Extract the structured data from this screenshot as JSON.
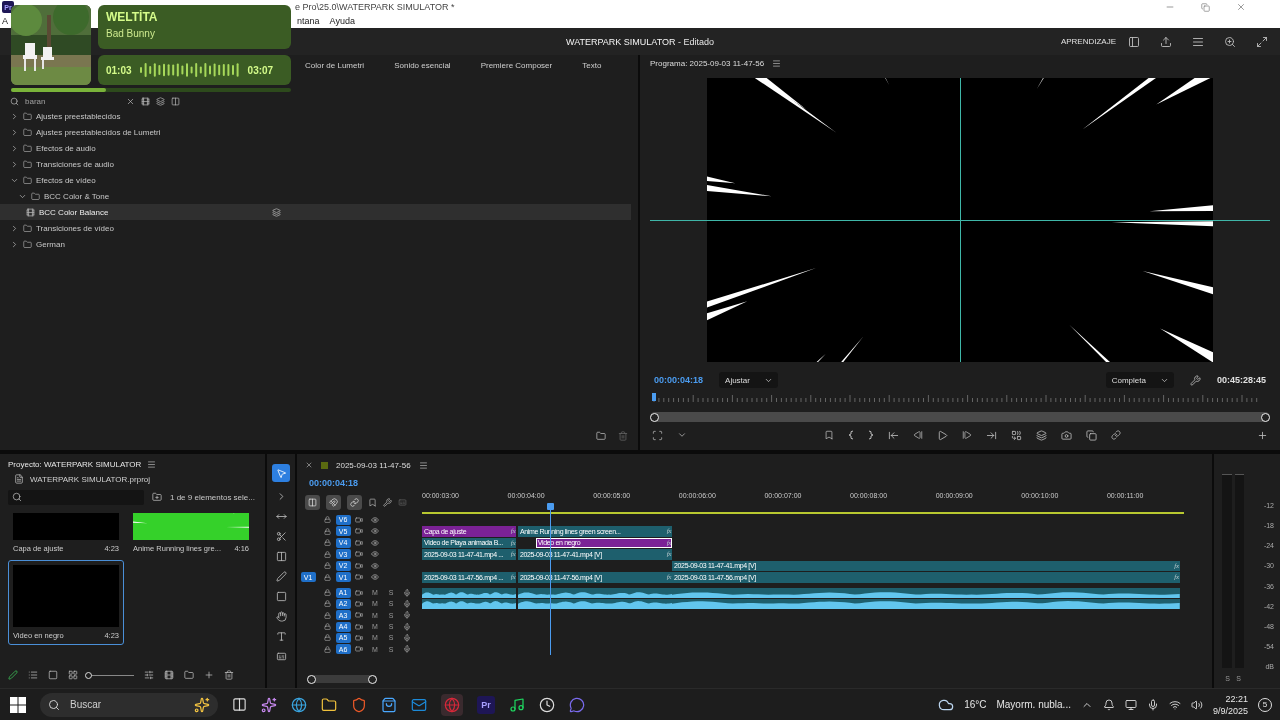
{
  "title_bar": {
    "app_badge": "Pr",
    "title": "e Pro\\25.0\\WATERPARK SIMULATOR *"
  },
  "menu": [
    "A",
    "ntana",
    "Ayuda"
  ],
  "header": {
    "title": "WATERPARK SIMULATOR",
    "status": "- Editado",
    "learn": "APRENDIZAJE"
  },
  "now_playing": {
    "title": "WELTİTA",
    "artist": "Bad Bunny",
    "elapsed": "01:03",
    "total": "03:07",
    "level": 0.34
  },
  "effects": {
    "tabs": [
      {
        "label": "Color de Lumetri",
        "selected": false
      },
      {
        "label": "Sonido esencial",
        "selected": false
      },
      {
        "label": "Premiere Composer",
        "selected": false
      },
      {
        "label": "Texto",
        "selected": false
      }
    ],
    "search": {
      "value": "baran"
    },
    "tree": [
      {
        "label": "Ajustes preestablecidos",
        "expanded": false,
        "selected": false
      },
      {
        "label": "Ajustes preestablecidos de Lumetri",
        "expanded": false,
        "selected": false
      },
      {
        "label": "Efectos de audio",
        "expanded": false,
        "selected": false
      },
      {
        "label": "Transiciones de audio",
        "expanded": false,
        "selected": false
      },
      {
        "label": "Efectos de vídeo",
        "expanded": true,
        "selected": false,
        "children": [
          {
            "label": "BCC Color & Tone",
            "expanded": true,
            "selected": false,
            "children": [
              {
                "label": "BCC Color Balance",
                "kind": "effect",
                "selected": true
              }
            ]
          }
        ]
      },
      {
        "label": "Transiciones de vídeo",
        "expanded": false,
        "selected": false
      },
      {
        "label": "German",
        "expanded": false,
        "selected": false
      }
    ]
  },
  "program": {
    "title": "Programa: 2025-09-03 11-47-56",
    "timecode": "00:00:04:18",
    "fit": "Ajustar",
    "quality": "Completa",
    "duration": "00:45:28:45"
  },
  "project": {
    "title": "Proyecto: WATERPARK SIMULATOR",
    "file": "WATERPARK SIMULATOR.prproj",
    "selection_count": "1 de 9 elementos sele...",
    "zoom_slider": {
      "level": 0
    },
    "items": [
      {
        "name": "Capa de ajuste",
        "duration": "4:23",
        "kind": "black",
        "selected": false
      },
      {
        "name": "Anime Running lines gre...",
        "duration": "4:16",
        "kind": "green",
        "selected": false
      },
      {
        "name": "Video en negro",
        "duration": "4:23",
        "kind": "black",
        "selected": true
      }
    ]
  },
  "timeline": {
    "sequence": "2025-09-03 11-47-56",
    "timecode": "00:00:04:18",
    "ruler": [
      "00:00:03:00",
      "00:00:04:00",
      "00:00:05:00",
      "00:00:06:00",
      "00:00:07:00",
      "00:00:08:00",
      "00:00:09:00",
      "00:00:10:00",
      "00:00:11:00"
    ],
    "video_tracks": [
      {
        "name": "V6"
      },
      {
        "name": "V5",
        "clips": [
          {
            "label": "Capa de ajuste",
            "color": "#7b2296",
            "fx": "fx",
            "selected": false
          },
          {
            "label": "Anime Running lines green screen...",
            "color": "#1e5f6d",
            "fx": "fx",
            "selected": false
          }
        ]
      },
      {
        "name": "V4",
        "clips": [
          {
            "label": "Video de Playa animada B...",
            "color": "#1e5f6d",
            "fx": "fx",
            "selected": false
          },
          {
            "label": "Video en negro",
            "color": "#7b2296",
            "fx": "fx",
            "selected": true
          }
        ]
      },
      {
        "name": "V3",
        "clips": [
          {
            "label": "2025-09-03 11-47-41.mp4 ...",
            "color": "#1e5f6d",
            "fx": "fx",
            "selected": false
          },
          {
            "label": "2025-09-03 11-47-41.mp4 [V]",
            "color": "#1e5f6d",
            "fx": "fx",
            "selected": false
          }
        ]
      },
      {
        "name": "V2",
        "clips": [
          {
            "label": "2025-09-03 11-47-41.mp4 [V]",
            "color": "#1e5f6d",
            "fx": "fx",
            "selected": false
          }
        ]
      },
      {
        "name": "V1",
        "source": "V1",
        "clips": [
          {
            "label": "2025-09-03 11-47-56.mp4 ...",
            "color": "#1e5f6d",
            "fx": "fx",
            "selected": false
          },
          {
            "label": "2025-09-03 11-47-56.mp4 [V]",
            "color": "#1e5f6d",
            "fx": "fx",
            "selected": false
          },
          {
            "label": "2025-09-03 11-47-56.mp4 [V]",
            "color": "#1e5f6d",
            "fx": "fx",
            "selected": false
          }
        ]
      }
    ],
    "audio_tracks": [
      {
        "name": "A1",
        "mute": "M",
        "solo": "S",
        "clips": [
          {
            "kind": "audio"
          },
          {
            "kind": "audio"
          },
          {
            "kind": "audio"
          }
        ]
      },
      {
        "name": "A2",
        "mute": "M",
        "solo": "S",
        "clips": [
          {
            "kind": "audio"
          },
          {
            "kind": "audio"
          },
          {
            "kind": "audio"
          }
        ]
      },
      {
        "name": "A3",
        "mute": "M",
        "solo": "S"
      },
      {
        "name": "A4",
        "mute": "M",
        "solo": "S"
      },
      {
        "name": "A5",
        "mute": "M",
        "solo": "S"
      },
      {
        "name": "A6",
        "mute": "M",
        "solo": "S"
      }
    ]
  },
  "meter": {
    "scale": [
      "-12",
      "-18",
      "-24",
      "-30",
      "-36",
      "-42",
      "-48",
      "-54",
      "dB"
    ],
    "solo": [
      "S",
      "S"
    ]
  },
  "taskbar": {
    "search": {
      "placeholder": "Buscar"
    },
    "app_badge": "Pr",
    "weather": {
      "temperature": "16°C",
      "condition": "Mayorm. nubla..."
    },
    "time": "22:21",
    "date": "9/9/2025",
    "notifications": "5"
  }
}
